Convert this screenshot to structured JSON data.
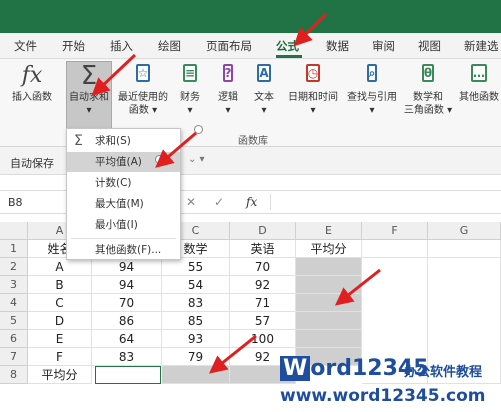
{
  "menu": {
    "tabs": [
      "文件",
      "开始",
      "插入",
      "绘图",
      "页面布局",
      "公式",
      "数据",
      "审阅",
      "视图",
      "新建选"
    ]
  },
  "ribbon": {
    "insert_function": "插入函数",
    "autosum": "自动求和",
    "recent_line1": "最近使用的",
    "recent_line2": "函数",
    "financial": "财务",
    "logical": "逻辑",
    "text": "文本",
    "datetime": "日期和时间",
    "lookup": "查找与引用",
    "math_line1": "数学和",
    "math_line2": "三角函数",
    "more": "其他函数",
    "group_label": "函数库"
  },
  "qat": {
    "autosave_label": "自动保存"
  },
  "formula_bar": {
    "name_box": "B8",
    "fx": "fx"
  },
  "dropdown": {
    "items": [
      {
        "label": "求和(S)",
        "icon": "sigma"
      },
      {
        "label": "平均值(A)",
        "icon": ""
      },
      {
        "label": "计数(C)",
        "icon": ""
      },
      {
        "label": "最大值(M)",
        "icon": ""
      },
      {
        "label": "最小值(I)",
        "icon": ""
      },
      {
        "label": "其他函数(F)...",
        "icon": ""
      }
    ]
  },
  "sheet": {
    "columns": [
      "A",
      "B",
      "C",
      "D",
      "E",
      "F",
      "G"
    ],
    "rows": [
      "1",
      "2",
      "3",
      "4",
      "5",
      "6",
      "7",
      "8"
    ],
    "header_row": [
      "姓名",
      "",
      "数学",
      "英语",
      "平均分"
    ],
    "data": [
      [
        "A",
        "94",
        "55",
        "70"
      ],
      [
        "B",
        "94",
        "54",
        "92"
      ],
      [
        "C",
        "70",
        "83",
        "71"
      ],
      [
        "D",
        "86",
        "85",
        "57"
      ],
      [
        "E",
        "64",
        "93",
        "100"
      ],
      [
        "F",
        "83",
        "79",
        "92"
      ]
    ],
    "row8_label": "平均分"
  },
  "watermark": {
    "brand": "ord12345",
    "brand_w": "W",
    "side": "办公软件教程",
    "url": "www.word12345.com"
  },
  "colors": {
    "titlebar": "#217346",
    "selected_gray": "#cfcfcf",
    "arrow_red": "#e02020"
  }
}
